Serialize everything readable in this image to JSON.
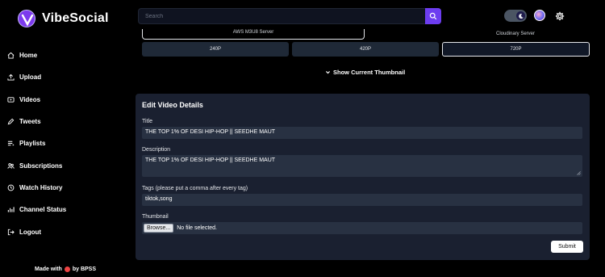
{
  "brand": {
    "name": "VibeSocial"
  },
  "sidebar": {
    "items": [
      {
        "label": "Home",
        "icon": "home-icon"
      },
      {
        "label": "Upload",
        "icon": "upload-icon"
      },
      {
        "label": "Videos",
        "icon": "video-icon"
      },
      {
        "label": "Tweets",
        "icon": "tweet-icon"
      },
      {
        "label": "Playlists",
        "icon": "playlist-icon"
      },
      {
        "label": "Subscriptions",
        "icon": "subscriptions-icon"
      },
      {
        "label": "Watch History",
        "icon": "history-icon"
      },
      {
        "label": "Channel Status",
        "icon": "channel-status-icon"
      },
      {
        "label": "Logout",
        "icon": "logout-icon"
      }
    ],
    "footer": {
      "made_with": "Made with",
      "by": "by BPSS"
    }
  },
  "search": {
    "placeholder": "Search"
  },
  "servers": {
    "aws": "AWS M3U8 Server",
    "cloudinary": "Cloudinary Server"
  },
  "qualities": [
    "240P",
    "420P",
    "720P"
  ],
  "thumbnail_toggle": "Show Current Thumbnail",
  "edit": {
    "title": "Edit Video Details",
    "title_label": "Title",
    "title_value": "THE TOP 1% OF DESI HIP-HOP || SEEDHE MAUT",
    "description_label": "Description",
    "description_value": "THE TOP 1% OF DESI HIP-HOP || SEEDHE MAUT",
    "tags_label": "Tags (please put a comma after every tag)",
    "tags_value": "tiktok,song",
    "thumbnail_label": "Thumbnail",
    "browse_label": "Browse...",
    "no_file": "No file selected.",
    "submit_label": "Submit"
  },
  "colors": {
    "accent": "#6d3df0",
    "panel": "#1a2030",
    "field": "#283142"
  }
}
